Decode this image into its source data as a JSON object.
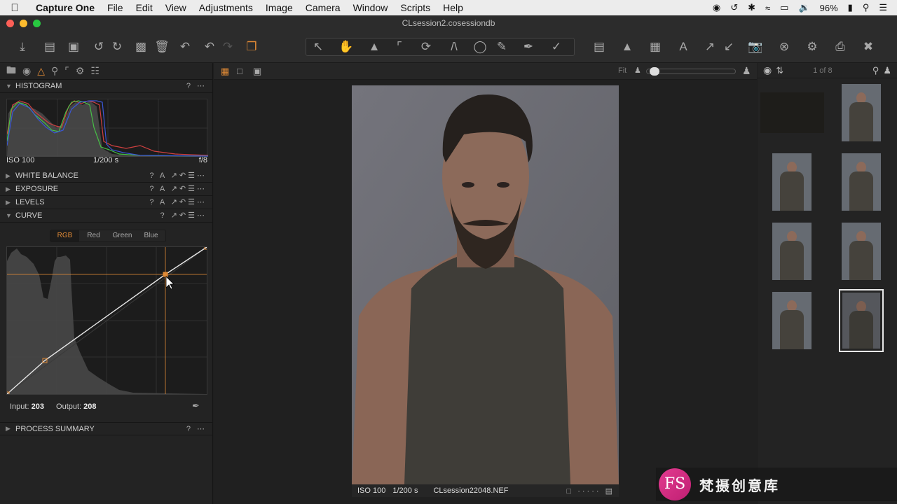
{
  "menubar": {
    "apple": "",
    "items": [
      "Capture One",
      "File",
      "Edit",
      "View",
      "Adjustments",
      "Image",
      "Camera",
      "Window",
      "Scripts",
      "Help"
    ],
    "battery": "96%"
  },
  "window": {
    "title": "CLsession2.cosessiondb"
  },
  "left_panel": {
    "histogram": {
      "label": "HISTOGRAM",
      "iso": "ISO 100",
      "shutter": "1/200 s",
      "aperture": "f/8"
    },
    "sections": [
      "WHITE BALANCE",
      "EXPOSURE",
      "LEVELS",
      "CURVE"
    ],
    "curve": {
      "tabs": [
        "RGB",
        "Red",
        "Green",
        "Blue"
      ],
      "input_label": "Input:",
      "input_value": "203",
      "output_label": "Output:",
      "output_value": "208"
    },
    "process_summary": "PROCESS SUMMARY"
  },
  "viewer": {
    "fit_label": "Fit",
    "caption": {
      "iso": "ISO 100",
      "shutter": "1/200 s",
      "filename": "CLsession22048.NEF"
    }
  },
  "browser": {
    "count": "1 of 8"
  },
  "watermark": {
    "logo": "FS",
    "text": "梵摄创意库"
  },
  "colors": {
    "accent": "#e08a36",
    "panel": "#232323",
    "viewer_bg": "#202020"
  }
}
